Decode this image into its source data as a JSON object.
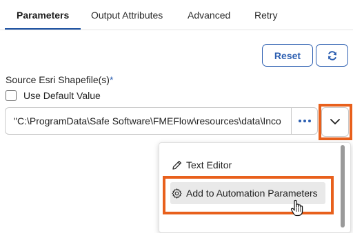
{
  "tabs": [
    {
      "label": "Parameters",
      "active": true
    },
    {
      "label": "Output Attributes",
      "active": false
    },
    {
      "label": "Advanced",
      "active": false
    },
    {
      "label": "Retry",
      "active": false
    }
  ],
  "toolbar": {
    "reset_label": "Reset",
    "refresh_icon": "refresh-icon"
  },
  "field": {
    "label": "Source Esri Shapefile(s)",
    "required_mark": "*",
    "use_default_label": "Use Default Value",
    "use_default_checked": false,
    "value": "\"C:\\ProgramData\\Safe Software\\FMEFlow\\resources\\data\\Inco"
  },
  "menu": {
    "items": [
      {
        "label": "Text Editor",
        "icon": "pencil-icon"
      },
      {
        "label": "Add to Automation Parameters",
        "icon": "gear-icon",
        "hovered": true
      }
    ]
  },
  "colors": {
    "accent": "#2a5db0",
    "highlight": "#e8601c"
  }
}
